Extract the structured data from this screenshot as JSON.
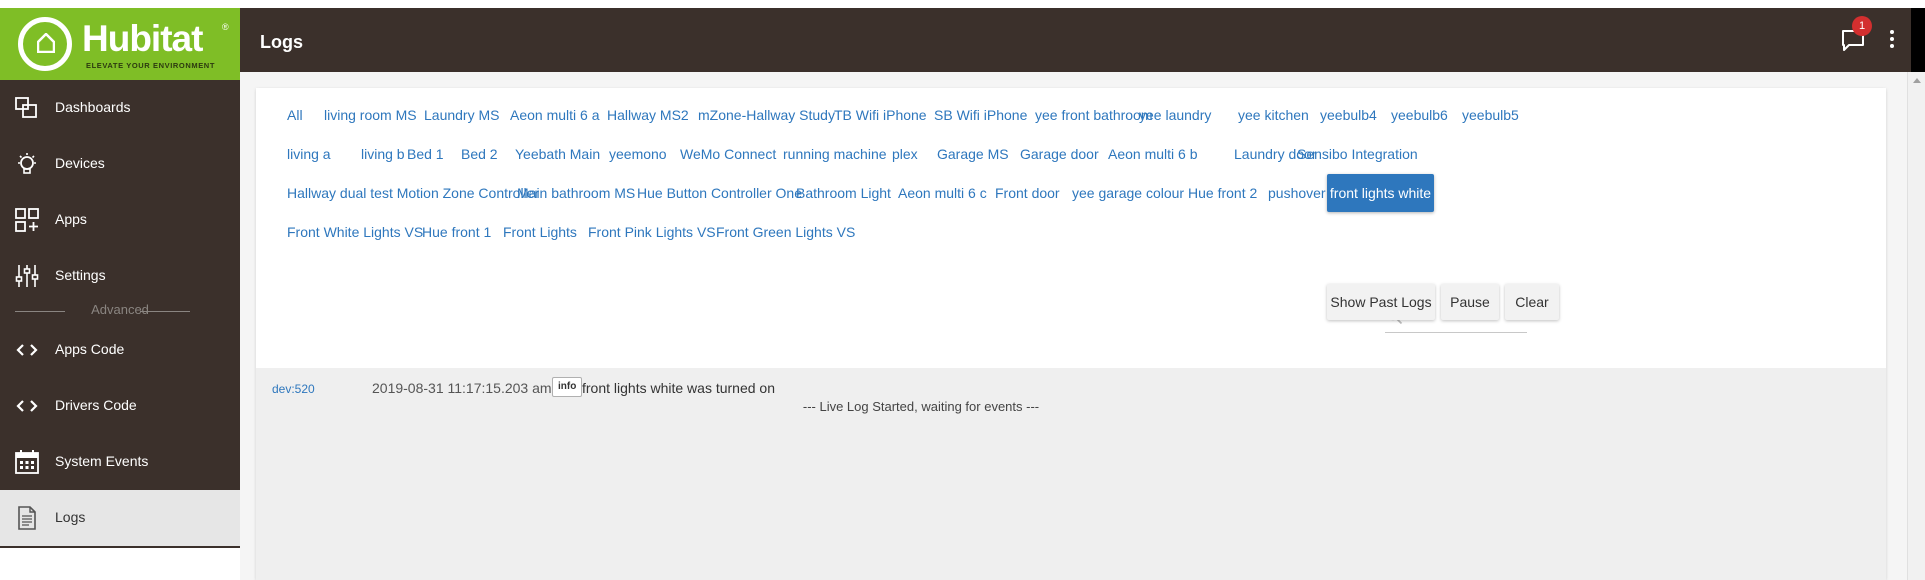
{
  "brand": {
    "name": "Hubitat",
    "tagline": "ELEVATE YOUR ENVIRONMENT",
    "reg": "®",
    "color": "#7fbe26"
  },
  "nav": {
    "items": [
      {
        "label": "Dashboards",
        "icon": "dashboards-icon"
      },
      {
        "label": "Devices",
        "icon": "bulb-icon"
      },
      {
        "label": "Apps",
        "icon": "apps-grid-icon"
      },
      {
        "label": "Settings",
        "icon": "sliders-icon"
      }
    ],
    "advanced_label": "Advanced",
    "advanced_items": [
      {
        "label": "Apps Code",
        "icon": "code-icon"
      },
      {
        "label": "Drivers Code",
        "icon": "code-icon"
      },
      {
        "label": "System Events",
        "icon": "calendar-icon"
      },
      {
        "label": "Logs",
        "icon": "document-icon",
        "active": true
      }
    ]
  },
  "header": {
    "title": "Logs",
    "notification_count": "1"
  },
  "device_filters": [
    "All",
    "living room MS",
    "Laundry MS",
    "Aeon multi 6 a",
    "Hallway MS2",
    "mZone-Hallway Study",
    "TB Wifi iPhone",
    "SB Wifi iPhone",
    "yee front bathroom",
    "yee laundry",
    "yee kitchen",
    "yeebulb4",
    "yeebulb6",
    "yeebulb5",
    "living a",
    "living b",
    "Bed 1",
    "Bed 2",
    "Yeebath Main",
    "yeemono",
    "WeMo Connect",
    "running machine",
    "plex",
    "Garage MS",
    "Garage door",
    "Aeon multi 6 b",
    "Laundry door",
    "Sensibo Integration",
    "Hallway dual test Motion Zone Controller",
    "Main bathroom MS",
    "Hue Button Controller One",
    "Bathroom Light",
    "Aeon multi 6 c",
    "Front door",
    "yee garage colour",
    "Hue front 2",
    "pushover",
    "front lights white",
    "Front White Lights VS",
    "Hue front 1",
    "Front Lights",
    "Front Pink Lights VS",
    "Front Green Lights VS"
  ],
  "selected_filter": "front lights white",
  "search": {
    "placeholder": "",
    "value": ""
  },
  "actions": {
    "show_past": "Show Past Logs",
    "pause": "Pause",
    "clear": "Clear"
  },
  "log": {
    "entries": [
      {
        "device": "dev:520",
        "time": "2019-08-31 11:17:15.203 am",
        "level": "info",
        "message": "front lights white was turned on"
      }
    ],
    "status": "--- Live Log Started, waiting for events ---"
  },
  "colors": {
    "header": "#3b302b",
    "link": "#2e77bd",
    "selected": "#2e77bd",
    "badge": "#d32f2f"
  }
}
